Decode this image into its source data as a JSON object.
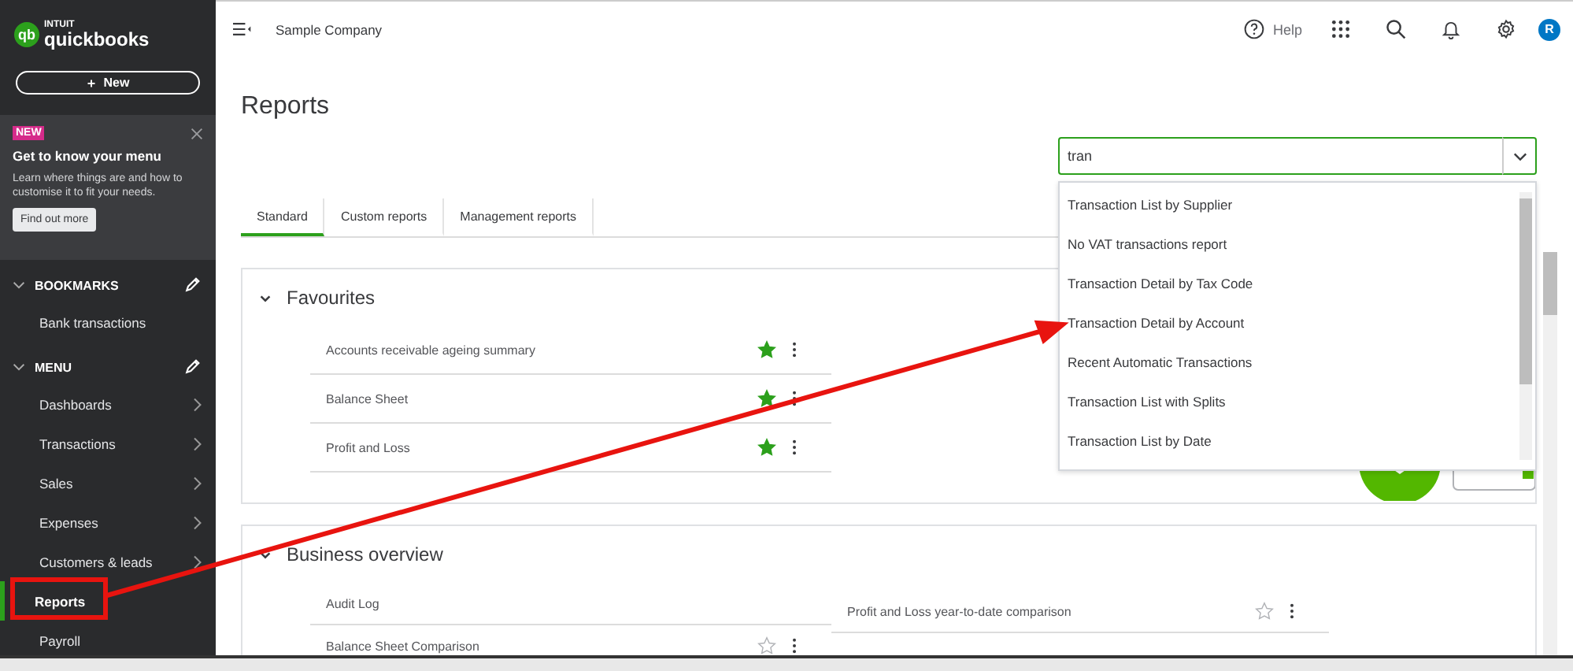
{
  "sidebar": {
    "logo": {
      "mark": "qb",
      "maker": "INTUIT",
      "product": "quickbooks"
    },
    "new_button": "New",
    "promo": {
      "badge": "NEW",
      "title": "Get to know your menu",
      "text": "Learn where things are and how to customise it to fit your needs.",
      "button": "Find out more"
    },
    "sections": [
      {
        "title": "BOOKMARKS",
        "expanded": true,
        "items": [
          {
            "label": "Bank transactions",
            "selected": false,
            "submenu": false
          }
        ]
      },
      {
        "title": "MENU",
        "expanded": true,
        "items": [
          {
            "label": "Dashboards",
            "selected": false,
            "submenu": true
          },
          {
            "label": "Transactions",
            "selected": false,
            "submenu": true
          },
          {
            "label": "Sales",
            "selected": false,
            "submenu": true
          },
          {
            "label": "Expenses",
            "selected": false,
            "submenu": true
          },
          {
            "label": "Customers & leads",
            "selected": false,
            "submenu": true
          },
          {
            "label": "Reports",
            "selected": true,
            "submenu": false
          },
          {
            "label": "Payroll",
            "selected": false,
            "submenu": false
          }
        ]
      }
    ]
  },
  "topbar": {
    "company": "Sample Company",
    "help": "Help",
    "avatar": "R"
  },
  "page": {
    "title": "Reports",
    "search": {
      "value": "tran"
    },
    "suggestions": [
      {
        "label": "Transaction List by Supplier"
      },
      {
        "label": "No VAT transactions report"
      },
      {
        "label": "Transaction Detail by Tax Code"
      },
      {
        "label": "Transaction Detail by Account"
      },
      {
        "label": "Recent Automatic Transactions"
      },
      {
        "label": "Transaction List with Splits"
      },
      {
        "label": "Transaction List by Date"
      }
    ],
    "tabs": [
      {
        "label": "Standard",
        "selected": true
      },
      {
        "label": "Custom reports",
        "selected": false
      },
      {
        "label": "Management reports",
        "selected": false
      }
    ],
    "sections": [
      {
        "title": "Favourites",
        "expanded": true,
        "columns": [
          [
            {
              "label": "Accounts receivable ageing summary",
              "favourite": true
            },
            {
              "label": "Balance Sheet",
              "favourite": true
            },
            {
              "label": "Profit and Loss",
              "favourite": true
            }
          ]
        ]
      },
      {
        "title": "Business overview",
        "expanded": true,
        "columns": [
          [
            {
              "label": "Audit Log"
            },
            {
              "label": "Balance Sheet Comparison",
              "favourite": false
            }
          ],
          [
            {
              "label": "Profit and Loss year-to-date comparison",
              "favourite": false
            }
          ]
        ]
      }
    ]
  }
}
